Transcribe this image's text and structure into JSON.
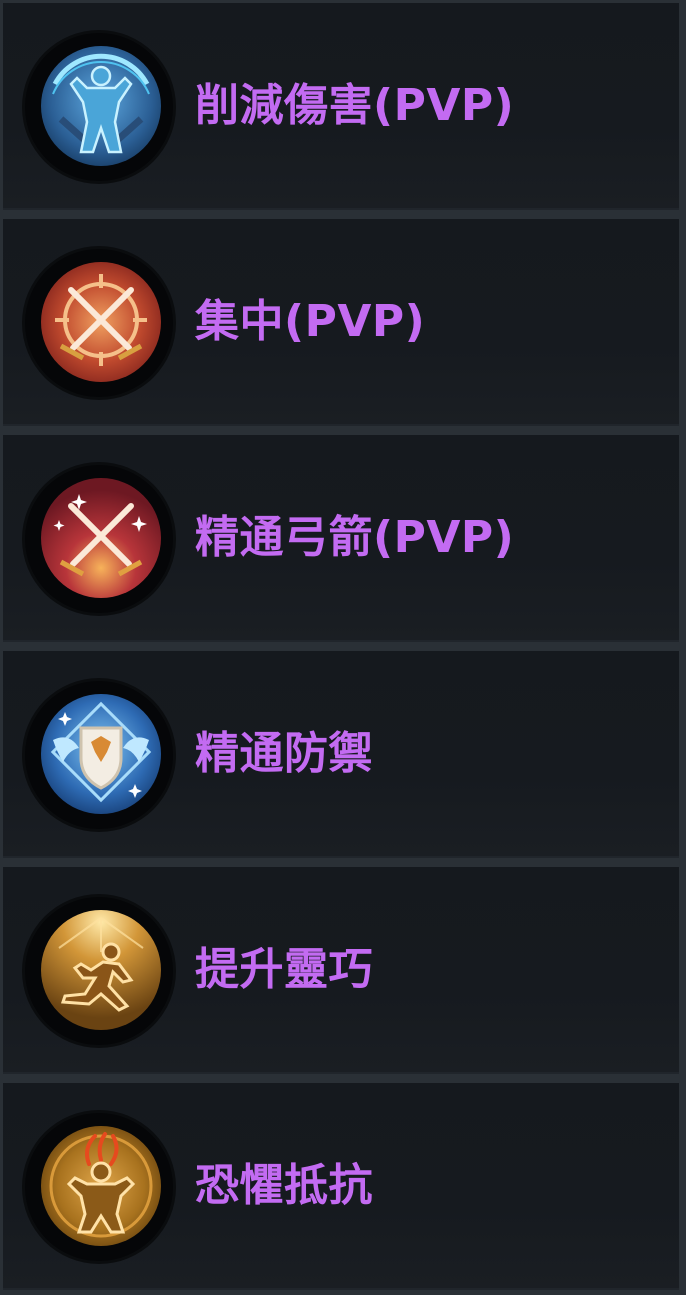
{
  "skills": [
    {
      "label": "削減傷害(PVP)",
      "icon": "warrior-stance-icon",
      "color": "#4a8ec9"
    },
    {
      "label": "集中(PVP)",
      "icon": "crossed-swords-target-icon",
      "color": "#b33a2a"
    },
    {
      "label": "精通弓箭(PVP)",
      "icon": "crossed-swords-sparkle-icon",
      "color": "#a82a35"
    },
    {
      "label": "精通防禦",
      "icon": "winged-shield-icon",
      "color": "#3f7fc4"
    },
    {
      "label": "提升靈巧",
      "icon": "dodging-figure-icon",
      "color": "#c08a2e"
    },
    {
      "label": "恐懼抵抗",
      "icon": "fear-resist-figure-icon",
      "color": "#b58325"
    }
  ],
  "colors": {
    "label_text": "#c36bf2",
    "row_background": "#15191e",
    "page_background": "#2a3036"
  }
}
